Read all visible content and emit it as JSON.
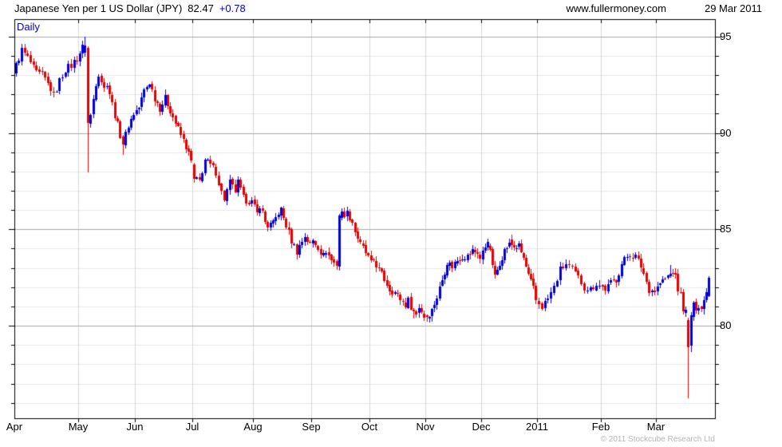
{
  "header": {
    "title_main": "Japanese Yen per 1 US Dollar (JPY)",
    "last_price": "82.47",
    "change": "+0.78",
    "website": "www.fullermoney.com",
    "date": "29 Mar 2011"
  },
  "chart": {
    "frequency_label": "Daily",
    "copyright": "© 2011 Stockcube Research Ltd"
  },
  "chart_data": {
    "type": "candlestick",
    "title": "Japanese Yen per 1 US Dollar (JPY)",
    "xlabel": "",
    "ylabel": "",
    "grid": true,
    "x_labels": [
      "Apr",
      "May",
      "Jun",
      "Jul",
      "Aug",
      "Sep",
      "Oct",
      "Nov",
      "Dec",
      "2011",
      "Feb",
      "Mar"
    ],
    "y_ticks": [
      95,
      90,
      85,
      80
    ],
    "y_minor_step": 1,
    "ylim": [
      75.2,
      95.9
    ],
    "last_close": 82.47,
    "change_value": 0.78,
    "colors": {
      "up": "#0000dd",
      "down": "#e60000",
      "grid_minor": "#e9e9e9",
      "grid_major": "#a9a9a9",
      "grid_vertical": "#d7d7d7",
      "frame": "#000000",
      "accent_blue": "#0000cd"
    },
    "month_candle_counts": [
      22,
      21,
      22,
      22,
      22,
      22,
      21,
      22,
      23,
      21,
      20,
      21
    ],
    "month_boundary_fractions": [
      0,
      0.0911,
      0.172,
      0.254,
      0.3405,
      0.4237,
      0.5068,
      0.5866,
      0.6663,
      0.746,
      0.8371,
      0.9157,
      0.993
    ],
    "first_open": 93.1,
    "close_noise": 0.4,
    "wick_noise": 0.22,
    "close_anchors": [
      [
        0,
        93.5
      ],
      [
        2,
        94.3
      ],
      [
        4,
        93.9
      ],
      [
        7,
        93.1
      ],
      [
        9,
        93.0
      ],
      [
        12,
        92.3
      ],
      [
        13,
        91.9
      ],
      [
        15,
        92.7
      ],
      [
        17,
        93.3
      ],
      [
        19,
        93.5
      ],
      [
        21,
        93.9
      ],
      [
        23,
        94.45
      ],
      [
        24,
        94.55
      ],
      [
        25,
        90.5
      ],
      [
        26,
        90.9
      ],
      [
        28,
        92.6
      ],
      [
        29,
        93.1
      ],
      [
        31,
        92.3
      ],
      [
        32,
        92.6
      ],
      [
        34,
        91.5
      ],
      [
        36,
        90.4
      ],
      [
        38,
        89.4
      ],
      [
        40,
        90.4
      ],
      [
        42,
        91.0
      ],
      [
        44,
        91.3
      ],
      [
        46,
        92.2
      ],
      [
        48,
        92.6
      ],
      [
        50,
        91.8
      ],
      [
        52,
        91.3
      ],
      [
        54,
        91.8
      ],
      [
        56,
        91.2
      ],
      [
        58,
        90.5
      ],
      [
        60,
        89.9
      ],
      [
        62,
        89.3
      ],
      [
        64,
        88.5
      ],
      [
        65,
        87.6
      ],
      [
        67,
        87.5
      ],
      [
        69,
        88.6
      ],
      [
        71,
        88.3
      ],
      [
        73,
        88.0
      ],
      [
        75,
        86.9
      ],
      [
        76,
        86.6
      ],
      [
        78,
        87.4
      ],
      [
        80,
        87.0
      ],
      [
        81,
        87.4
      ],
      [
        83,
        86.6
      ],
      [
        86,
        86.4
      ],
      [
        88,
        85.8
      ],
      [
        89,
        86.3
      ],
      [
        91,
        85.4
      ],
      [
        92,
        85.2
      ],
      [
        94,
        85.3
      ],
      [
        96,
        85.9
      ],
      [
        97,
        86.0
      ],
      [
        99,
        85.2
      ],
      [
        101,
        84.4
      ],
      [
        103,
        83.85
      ],
      [
        105,
        84.4
      ],
      [
        106,
        84.65
      ],
      [
        108,
        84.2
      ],
      [
        109,
        84.4
      ],
      [
        111,
        84.1
      ],
      [
        113,
        83.6
      ],
      [
        114,
        83.9
      ],
      [
        116,
        83.4
      ],
      [
        118,
        83.1
      ],
      [
        119,
        85.7
      ],
      [
        120,
        85.8
      ],
      [
        122,
        85.85
      ],
      [
        124,
        85.4
      ],
      [
        125,
        84.9
      ],
      [
        127,
        84.2
      ],
      [
        129,
        83.8
      ],
      [
        130,
        83.5
      ],
      [
        131,
        83.2
      ],
      [
        132,
        83.4
      ],
      [
        134,
        82.9
      ],
      [
        136,
        82.4
      ],
      [
        138,
        81.9
      ],
      [
        140,
        81.7
      ],
      [
        142,
        81.4
      ],
      [
        144,
        81.1
      ],
      [
        145,
        81.3
      ],
      [
        147,
        80.75
      ],
      [
        148,
        80.6
      ],
      [
        149,
        81.0
      ],
      [
        151,
        80.5
      ],
      [
        152,
        80.45
      ],
      [
        154,
        80.8
      ],
      [
        156,
        81.5
      ],
      [
        158,
        82.4
      ],
      [
        160,
        83.3
      ],
      [
        162,
        83.1
      ],
      [
        164,
        83.4
      ],
      [
        166,
        83.6
      ],
      [
        168,
        83.6
      ],
      [
        170,
        83.9
      ],
      [
        172,
        83.8
      ],
      [
        173,
        83.5
      ],
      [
        175,
        84.1
      ],
      [
        176,
        84.35
      ],
      [
        178,
        83.2
      ],
      [
        179,
        82.5
      ],
      [
        181,
        83.3
      ],
      [
        183,
        83.9
      ],
      [
        185,
        84.3
      ],
      [
        187,
        84.1
      ],
      [
        189,
        84.1
      ],
      [
        191,
        83.5
      ],
      [
        193,
        82.6
      ],
      [
        195,
        81.9
      ],
      [
        196,
        81.3
      ],
      [
        197,
        81.15
      ],
      [
        198,
        81.0
      ],
      [
        200,
        81.4
      ],
      [
        202,
        82.0
      ],
      [
        204,
        82.9
      ],
      [
        206,
        83.2
      ],
      [
        208,
        82.9
      ],
      [
        210,
        82.5
      ],
      [
        212,
        82.0
      ],
      [
        214,
        81.9
      ],
      [
        216,
        82.2
      ],
      [
        217,
        82.1
      ],
      [
        219,
        81.9
      ],
      [
        221,
        82.2
      ],
      [
        223,
        82.4
      ],
      [
        225,
        83.2
      ],
      [
        227,
        83.6
      ],
      [
        228,
        83.7
      ],
      [
        230,
        83.6
      ],
      [
        232,
        83.1
      ],
      [
        234,
        82.3
      ],
      [
        235,
        81.9
      ],
      [
        237,
        81.8
      ],
      [
        239,
        82.2
      ],
      [
        241,
        82.4
      ],
      [
        243,
        82.7
      ],
      [
        244,
        82.85
      ],
      [
        245,
        82.5
      ],
      [
        246,
        81.9
      ],
      [
        247,
        81.6
      ],
      [
        248,
        80.9
      ],
      [
        249,
        80.7
      ],
      [
        250,
        78.9
      ],
      [
        251,
        80.55
      ],
      [
        252,
        81.0
      ],
      [
        253,
        80.95
      ],
      [
        254,
        81.1
      ],
      [
        255,
        80.9
      ],
      [
        256,
        81.3
      ],
      [
        257,
        81.9
      ],
      [
        258,
        82.47
      ]
    ],
    "special_candles": {
      "24": [
        94.15,
        94.99,
        93.95,
        94.55
      ],
      "25": [
        94.4,
        94.5,
        87.95,
        90.5
      ],
      "38": [
        89.8,
        89.9,
        88.85,
        89.4
      ],
      "65": [
        88.35,
        88.45,
        87.4,
        87.6
      ],
      "118": [
        83.35,
        83.42,
        82.92,
        83.1
      ],
      "119": [
        83.05,
        85.78,
        82.87,
        85.7
      ],
      "147": [
        80.85,
        80.92,
        80.39,
        80.75
      ],
      "152": [
        80.52,
        80.6,
        80.22,
        80.45
      ],
      "176": [
        84.05,
        84.51,
        83.9,
        84.35
      ],
      "185": [
        84.12,
        84.51,
        84.0,
        84.3
      ],
      "243": [
        82.55,
        83.15,
        82.5,
        82.7
      ],
      "250": [
        80.3,
        80.42,
        76.25,
        78.9
      ],
      "251": [
        78.95,
        80.7,
        78.65,
        80.55
      ],
      "258": [
        81.55,
        82.55,
        81.5,
        82.47
      ]
    }
  }
}
